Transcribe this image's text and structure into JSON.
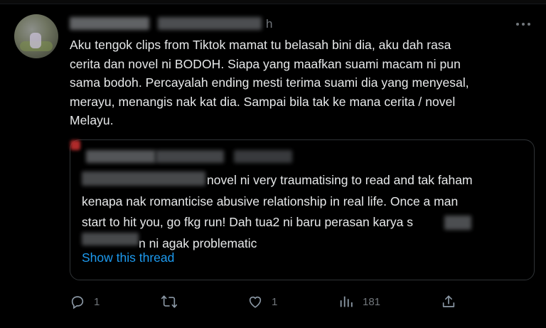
{
  "header": {
    "time_suffix": "h",
    "more_icon": "more-horizontal-icon"
  },
  "tweet": {
    "lines": [
      "Aku tengok clips from Tiktok mamat tu belasah bini dia, aku dah rasa",
      "cerita dan novel ni BODOH. Siapa yang maafkan suami macam ni pun",
      "sama bodoh. Percayalah ending mesti terima suami dia yang menyesal,",
      "merayu, menangis nak kat dia. Sampai bila tak ke mana cerita  / novel",
      "Melayu."
    ]
  },
  "quote": {
    "lines": [
      "novel ni very traumatising to read and tak faham",
      "kenapa nak romanticise abusive relationship in real life. Once a man",
      "start to hit you, go fkg run! Dah tua2 ni baru perasan karya s",
      "n ni agak problematic"
    ],
    "show_thread": "Show this thread"
  },
  "actions": {
    "reply": {
      "icon": "reply-icon",
      "count": "1"
    },
    "retweet": {
      "icon": "retweet-icon",
      "count": ""
    },
    "like": {
      "icon": "heart-icon",
      "count": "1"
    },
    "views": {
      "icon": "analytics-icon",
      "count": "181"
    },
    "share": {
      "icon": "share-icon",
      "count": ""
    }
  },
  "colors": {
    "background": "#000000",
    "text": "#e7e9ea",
    "muted": "#71767b",
    "link": "#1d9bf0",
    "border": "#2f3336"
  }
}
